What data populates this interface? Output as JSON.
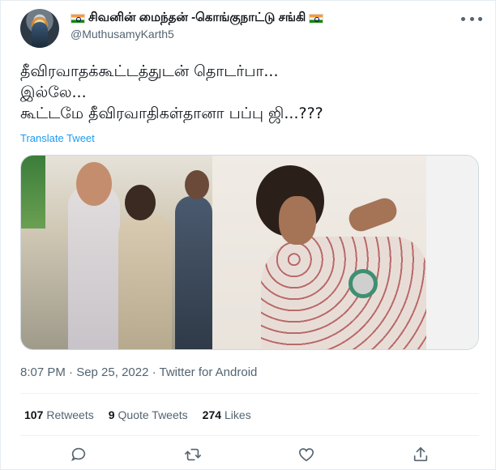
{
  "tweet": {
    "display_name": "சிவனின் மைந்தன் -கொங்குநாட்டு சங்கி",
    "handle": "@MuthusamyKarth5",
    "text_lines": [
      "தீவிரவாதக்கூட்டத்துடன் தொடர்பா...",
      "இல்லே...",
      "கூட்டமே தீவிரவாதிகள்தானா பப்பு ஜி...???"
    ],
    "translate_label": "Translate Tweet",
    "timestamp": "8:07 PM · Sep 25, 2022 · Twitter for Android"
  },
  "stats": {
    "retweets_count": "107",
    "retweets_label": "Retweets",
    "quotes_count": "9",
    "quotes_label": "Quote Tweets",
    "likes_count": "274",
    "likes_label": "Likes"
  },
  "icons": {
    "more": "more-icon",
    "reply": "reply-icon",
    "retweet": "retweet-icon",
    "like": "like-icon",
    "share": "share-icon",
    "flag": "india-flag-icon"
  },
  "colors": {
    "accent": "#1d9bf0",
    "secondary_text": "#536471",
    "primary_text": "#0f1419"
  }
}
